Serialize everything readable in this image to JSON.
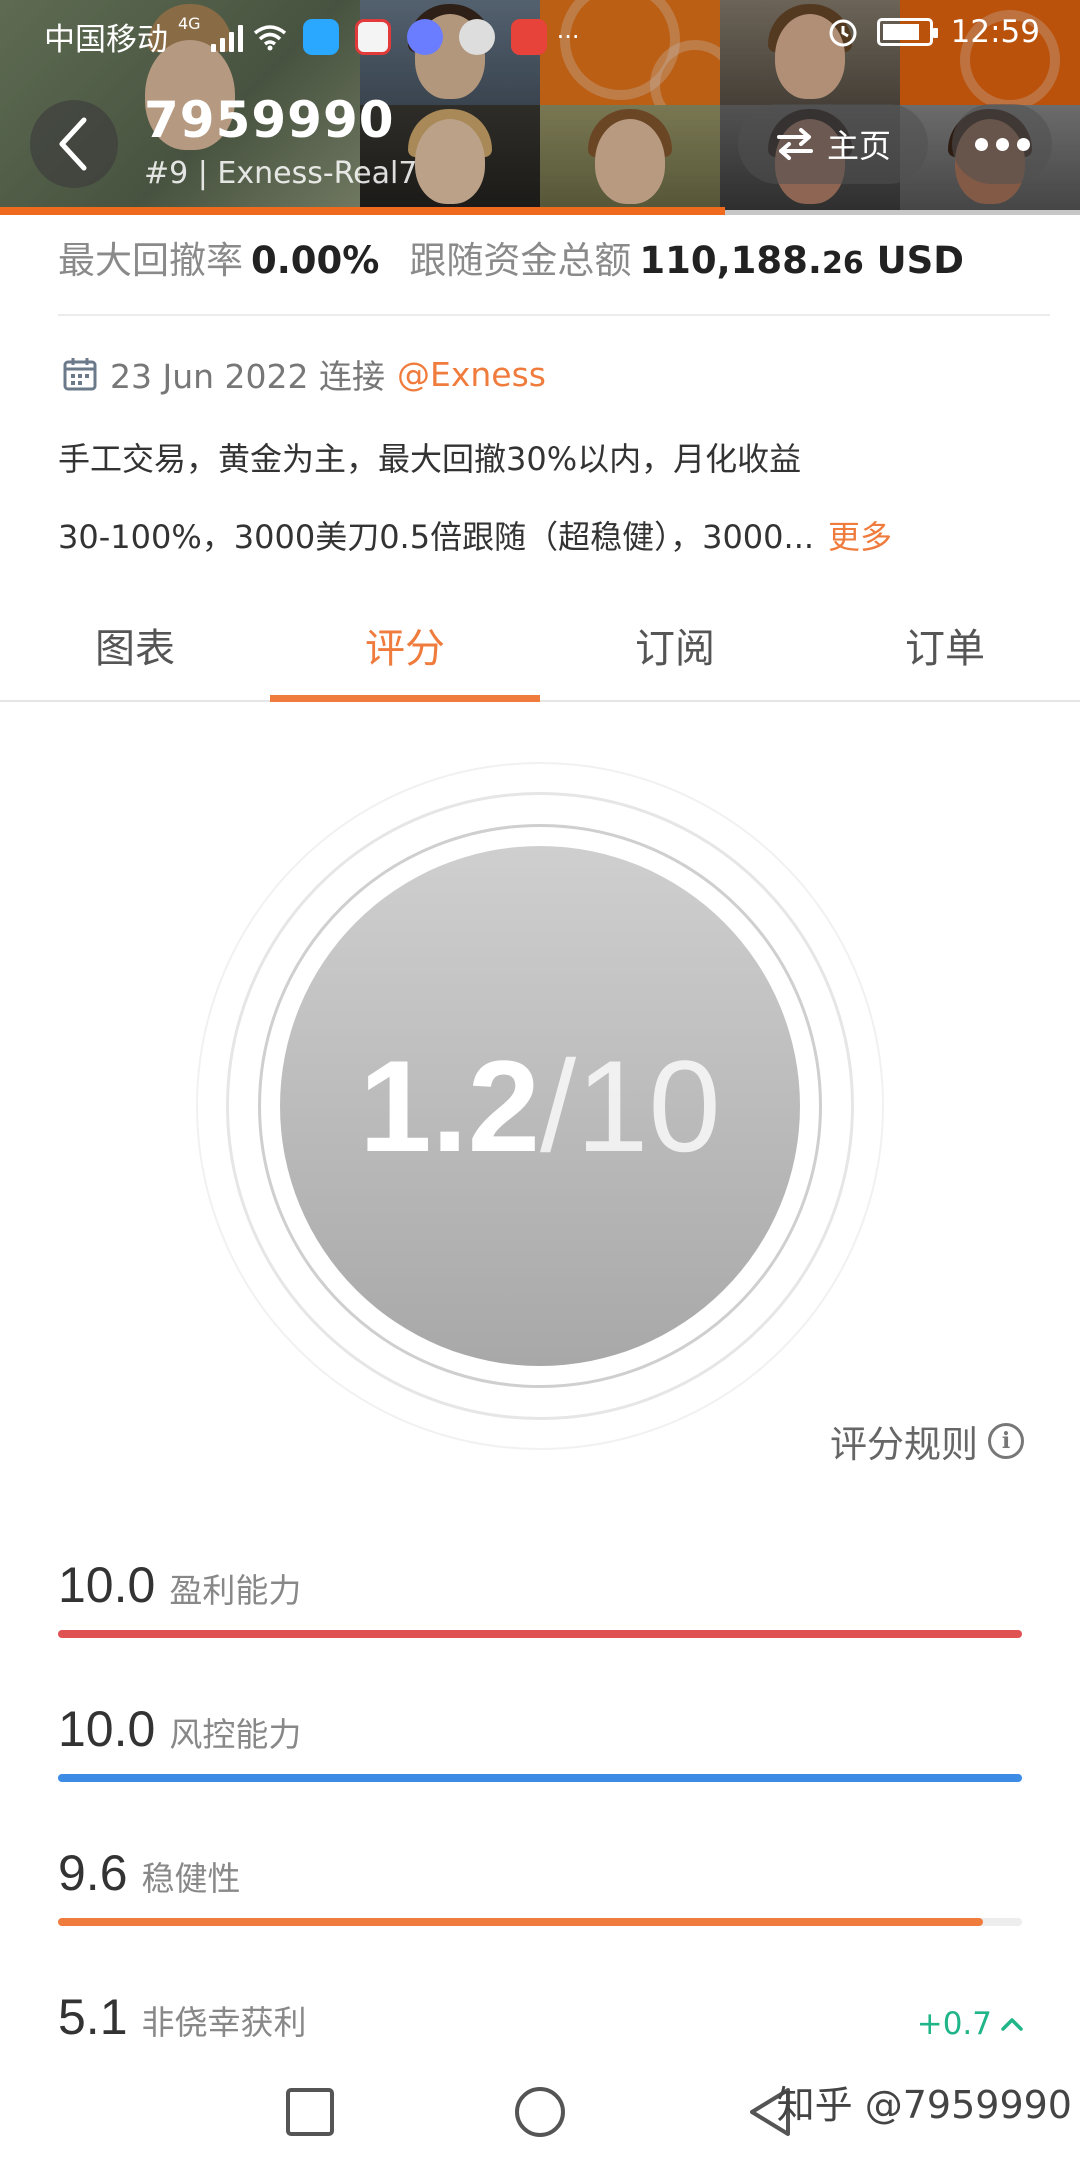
{
  "status_bar": {
    "carrier": "中国移动",
    "network": "4G",
    "time": "12:59",
    "icons": [
      "signal-icon",
      "wifi-icon",
      "app-icon",
      "alarm-icon",
      "battery-icon"
    ]
  },
  "header": {
    "title": "7959990",
    "subtitle": "#9 | Exness-Real7",
    "home_label": "主页",
    "accent_color": "#ef6a1d"
  },
  "stats": {
    "drawdown_label": "最大回撤率",
    "drawdown_value": "0.00%",
    "funds_label": "跟随资金总额",
    "funds_int": "110,188.",
    "funds_dec": "26",
    "funds_unit": "USD"
  },
  "connection": {
    "date": "23 Jun 2022 连接",
    "broker": "@Exness"
  },
  "description": {
    "line1": "手工交易，黄金为主，最大回撤30%以内，月化收益",
    "line2": "30-100%，3000美刀0.5倍跟随（超稳健），3000...",
    "more": "更多"
  },
  "tabs": [
    {
      "label": "图表",
      "active": false
    },
    {
      "label": "评分",
      "active": true
    },
    {
      "label": "订阅",
      "active": false
    },
    {
      "label": "订单",
      "active": false
    }
  ],
  "score": {
    "value": "1.2",
    "max": "/10"
  },
  "rules_label": "评分规则",
  "metrics": [
    {
      "value": "10.0",
      "label": "盈利能力",
      "fraction": 1.0,
      "color": "#e05252"
    },
    {
      "value": "10.0",
      "label": "风控能力",
      "fraction": 1.0,
      "color": "#3c8ce6"
    },
    {
      "value": "9.6",
      "label": "稳健性",
      "fraction": 0.96,
      "color": "#ef7c3d"
    },
    {
      "value": "5.1",
      "label": "非侥幸获利"
    }
  ],
  "delta": "+0.7",
  "watermark": "知乎 @7959990"
}
